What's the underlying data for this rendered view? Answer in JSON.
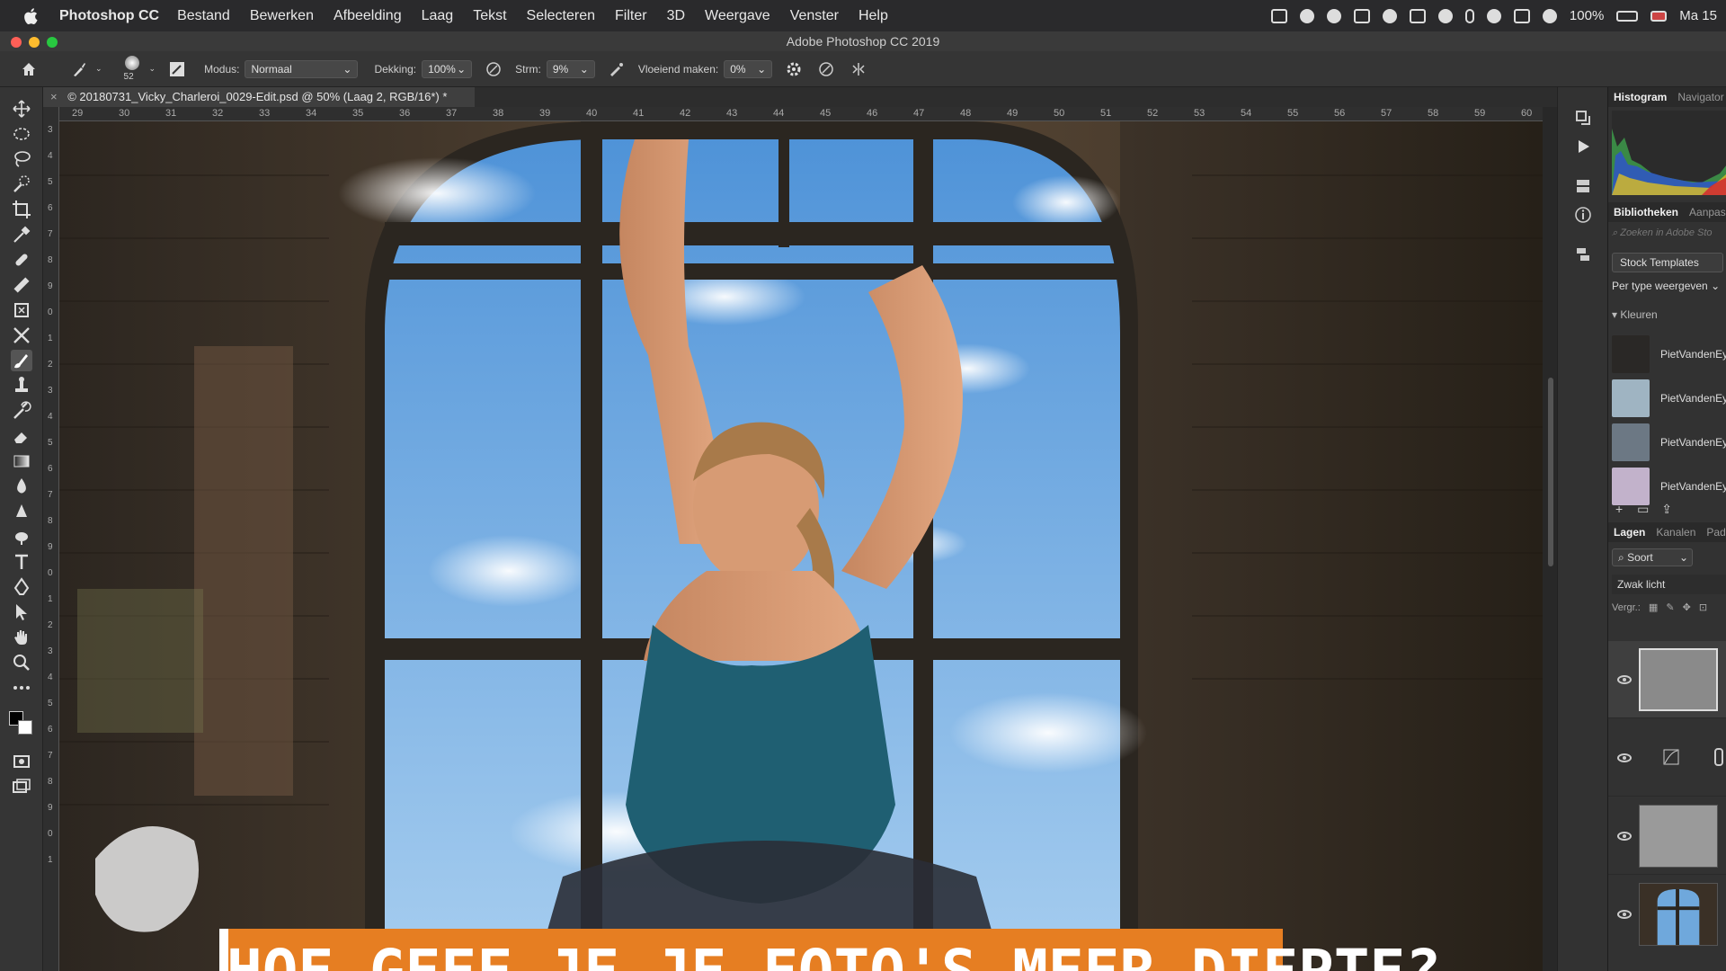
{
  "menubar": {
    "app_name": "Photoshop CC",
    "items": [
      "Bestand",
      "Bewerken",
      "Afbeelding",
      "Laag",
      "Tekst",
      "Selecteren",
      "Filter",
      "3D",
      "Weergave",
      "Venster",
      "Help"
    ],
    "battery": "100%",
    "clock": "Ma 15"
  },
  "window": {
    "title": "Adobe Photoshop CC 2019"
  },
  "options": {
    "brush_size": "52",
    "mode_label": "Modus:",
    "mode_value": "Normaal",
    "opacity_label": "Dekking:",
    "opacity_value": "100%",
    "flow_label": "Strm:",
    "flow_value": "9%",
    "smoothing_label": "Vloeiend maken:",
    "smoothing_value": "0%"
  },
  "document": {
    "tab_title": "© 20180731_Vicky_Charleroi_0029-Edit.psd @ 50% (Laag 2, RGB/16*) *"
  },
  "ruler": {
    "h_ticks": [
      "29",
      "30",
      "31",
      "32",
      "33",
      "34",
      "35",
      "36",
      "37",
      "38",
      "39",
      "40",
      "41",
      "42",
      "43",
      "44",
      "45",
      "46",
      "47",
      "48",
      "49",
      "50",
      "51",
      "52",
      "53",
      "54",
      "55",
      "56",
      "57",
      "58",
      "59",
      "60"
    ],
    "v_ticks": [
      "3",
      "4",
      "5",
      "6",
      "7",
      "8",
      "9",
      "0",
      "1",
      "2",
      "3",
      "4",
      "5",
      "6",
      "7",
      "8",
      "9",
      "0",
      "1",
      "2",
      "3",
      "4",
      "5",
      "6",
      "7",
      "8",
      "9",
      "0",
      "1"
    ]
  },
  "canvas": {
    "headline": "HOE GEEF JE JE FOTO'S MEER DIEPTE?"
  },
  "panels": {
    "top_tabs": [
      "Histogram",
      "Navigator"
    ],
    "lib_tabs": [
      "Bibliotheken",
      "Aanpas"
    ],
    "search_placeholder": "Zoeken in Adobe Sto",
    "stock_button": "Stock Templates",
    "view_by": "Per type weergeven",
    "colors_section": "Kleuren",
    "swatches": [
      {
        "label": "PietVandenEy",
        "color": "#2a2826"
      },
      {
        "label": "PietVandenEy",
        "color": "#9fb4c2"
      },
      {
        "label": "PietVandenEy",
        "color": "#6c7884"
      },
      {
        "label": "PietVandenEy",
        "color": "#c2b2cb"
      }
    ],
    "layer_tabs": [
      "Lagen",
      "Kanalen",
      "Pad"
    ],
    "filter_kind": "Soort",
    "blend_mode": "Zwak licht",
    "lock_label": "Vergr.:"
  },
  "colors": {
    "banner": "#e67e22",
    "sky": "#7db4e6",
    "wall": "#4a3d30"
  }
}
